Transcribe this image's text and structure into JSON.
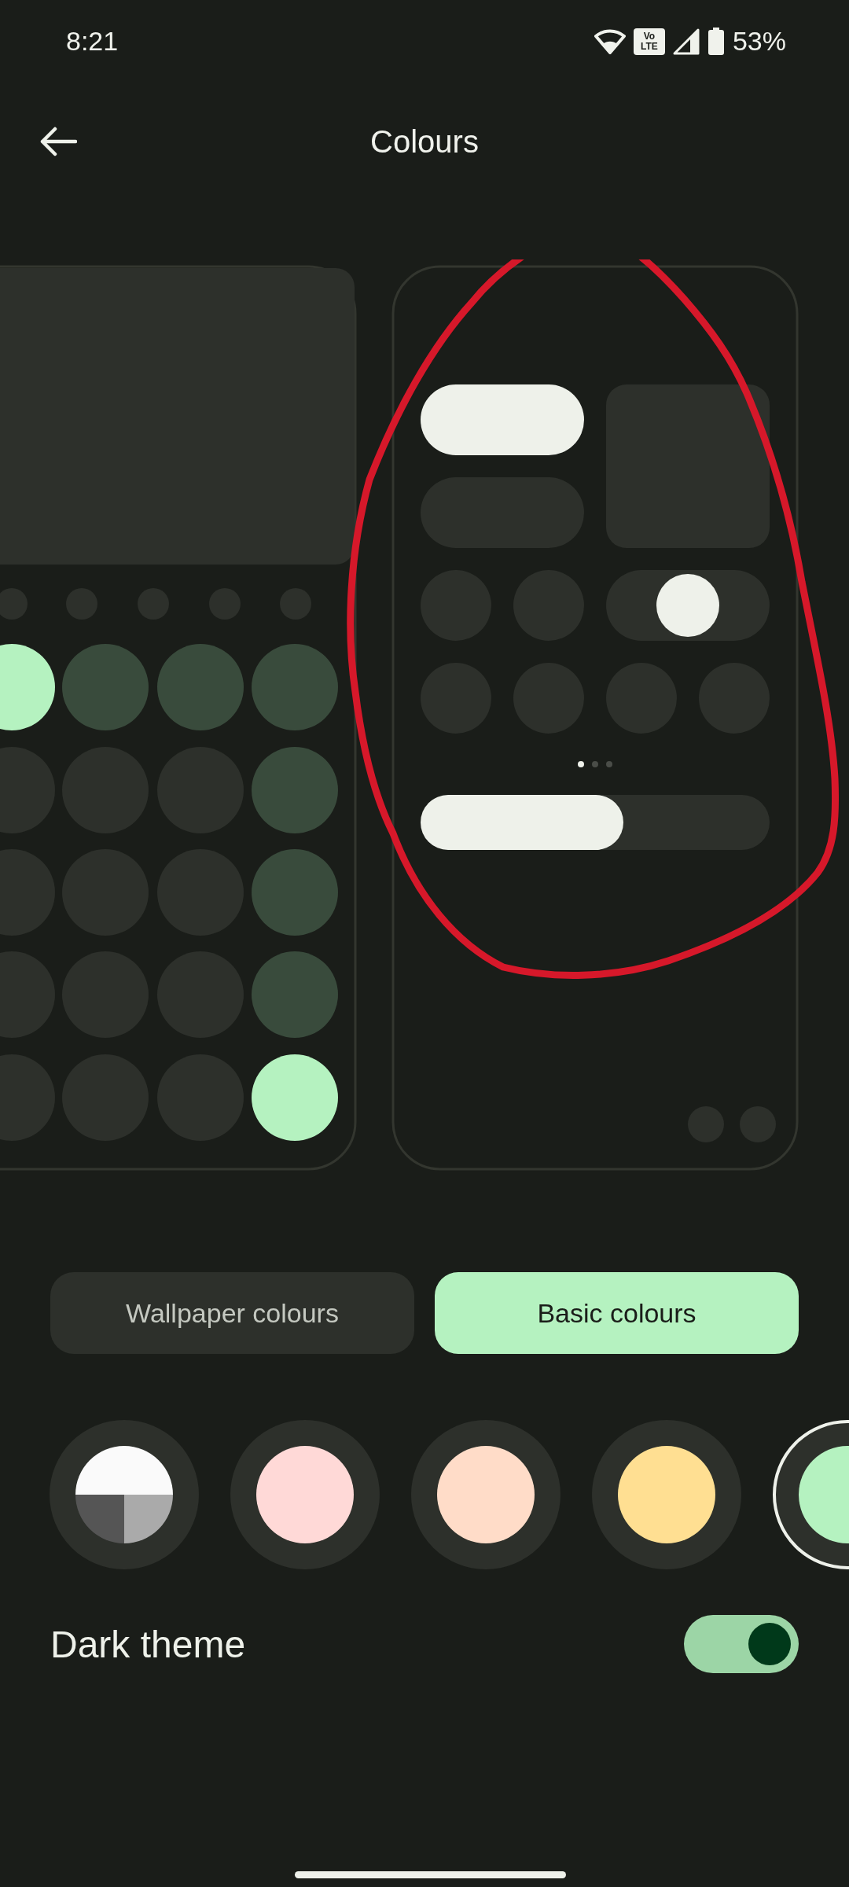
{
  "status_bar": {
    "time": "8:21",
    "network_badge": [
      "Vo",
      "LTE"
    ],
    "battery": "53%"
  },
  "top_bar": {
    "title": "Colours"
  },
  "tabs": [
    {
      "label": "Wallpaper colours",
      "selected": false
    },
    {
      "label": "Basic colours",
      "selected": true
    }
  ],
  "swatches": [
    {
      "kind": "tricolor",
      "selected": false
    },
    {
      "kind": "solid",
      "color": "#ffd9d7",
      "selected": false
    },
    {
      "kind": "solid",
      "color": "#ffdcc8",
      "selected": false
    },
    {
      "kind": "solid",
      "color": "#ffdf92",
      "selected": false
    },
    {
      "kind": "solid",
      "color": "#b5f2c0",
      "selected": true
    }
  ],
  "dark_theme": {
    "label": "Dark theme",
    "on": true
  }
}
